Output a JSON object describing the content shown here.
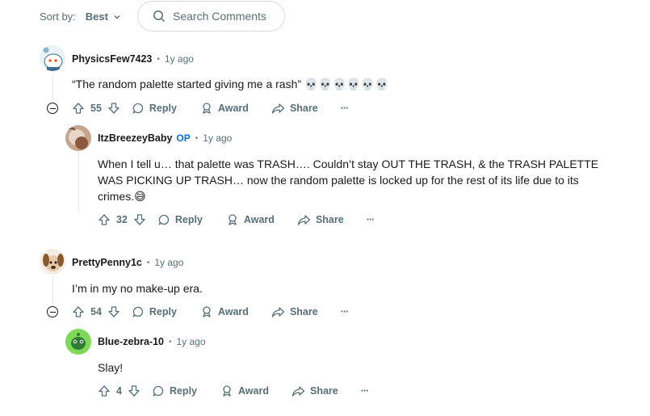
{
  "sort": {
    "label": "Sort by:",
    "value": "Best"
  },
  "search": {
    "placeholder": "Search Comments"
  },
  "action_labels": {
    "reply": "Reply",
    "award": "Award",
    "share": "Share",
    "more": "···"
  },
  "comments": [
    {
      "username": "PhysicsFew7423",
      "time": "1y ago",
      "body": "“The random palette started giving me a rash” 💀💀💀💀💀💀",
      "score": "55"
    },
    {
      "username": "ItzBreezeyBaby",
      "badge": "OP",
      "time": "1y ago",
      "body": "When I tell u… that palette was TRASH…. Couldn’t stay OUT THE TRASH, & the TRASH PALETTE WAS PICKING UP TRASH… now the random palette is locked up for the rest of its life due to its crimes.😅",
      "score": "32"
    },
    {
      "username": "PrettyPenny1c",
      "time": "1y ago",
      "body": "I’m in my no make-up era.",
      "score": "54"
    },
    {
      "username": "Blue-zebra-10",
      "time": "1y ago",
      "body": "Slay!",
      "score": "4"
    }
  ],
  "colors": {
    "text": "#1a1a1b",
    "muted": "#576f76",
    "op": "#0a6ee0",
    "thread": "#e5ebee"
  }
}
